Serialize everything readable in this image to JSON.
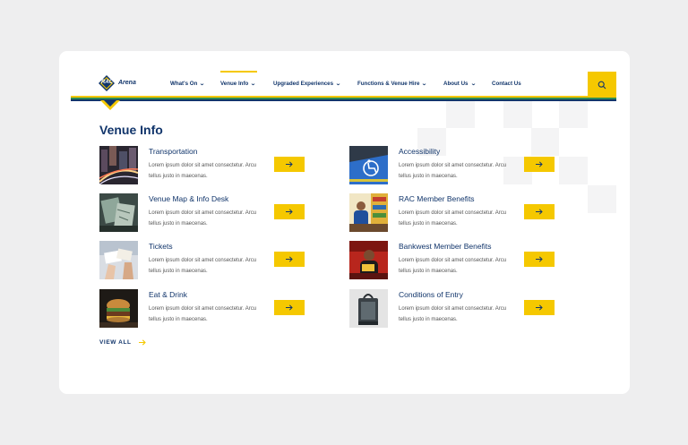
{
  "brand": {
    "logo_rac": "RAC",
    "logo_arena": "Arena"
  },
  "nav": {
    "items": [
      {
        "label": "What's On",
        "has_menu": true
      },
      {
        "label": "Venue Info",
        "has_menu": true,
        "active": true
      },
      {
        "label": "Upgraded Experiences",
        "has_menu": true
      },
      {
        "label": "Functions & Venue Hire",
        "has_menu": true
      },
      {
        "label": "About Us",
        "has_menu": true
      },
      {
        "label": "Contact Us",
        "has_menu": false
      }
    ],
    "chevron": "⌄"
  },
  "section": {
    "title": "Venue Info"
  },
  "items": [
    {
      "title": "Transportation",
      "desc": "Lorem ipsum dolor sit amet consectetur. Arcu tellus justo in maecenas.",
      "icon": "city-night-traffic-photo"
    },
    {
      "title": "Accessibility",
      "desc": "Lorem ipsum dolor sit amet consectetur. Arcu tellus justo in maecenas.",
      "icon": "accessible-parking-photo"
    },
    {
      "title": "Venue Map & Info Desk",
      "desc": "Lorem ipsum dolor sit amet consectetur. Arcu tellus justo in maecenas.",
      "icon": "venue-map-photo"
    },
    {
      "title": "RAC Member Benefits",
      "desc": "Lorem ipsum dolor sit amet consectetur. Arcu tellus justo in maecenas.",
      "icon": "member-benefits-photo"
    },
    {
      "title": "Tickets",
      "desc": "Lorem ipsum dolor sit amet consectetur. Arcu tellus justo in maecenas.",
      "icon": "tickets-photo"
    },
    {
      "title": "Bankwest Member Benefits",
      "desc": "Lorem ipsum dolor sit amet consectetur. Arcu tellus justo in maecenas.",
      "icon": "bankwest-benefits-photo"
    },
    {
      "title": "Eat & Drink",
      "desc": "Lorem ipsum dolor sit amet consectetur. Arcu tellus justo in maecenas.",
      "icon": "burger-photo"
    },
    {
      "title": "Conditions of Entry",
      "desc": "Lorem ipsum dolor sit amet consectetur. Arcu tellus justo in maecenas.",
      "icon": "clear-bag-photo"
    }
  ],
  "view_all": {
    "label": "VIEW ALL"
  },
  "colors": {
    "navy": "#11356b",
    "yellow": "#f5c800",
    "green": "#2e8b57",
    "background": "#eeeeef"
  }
}
